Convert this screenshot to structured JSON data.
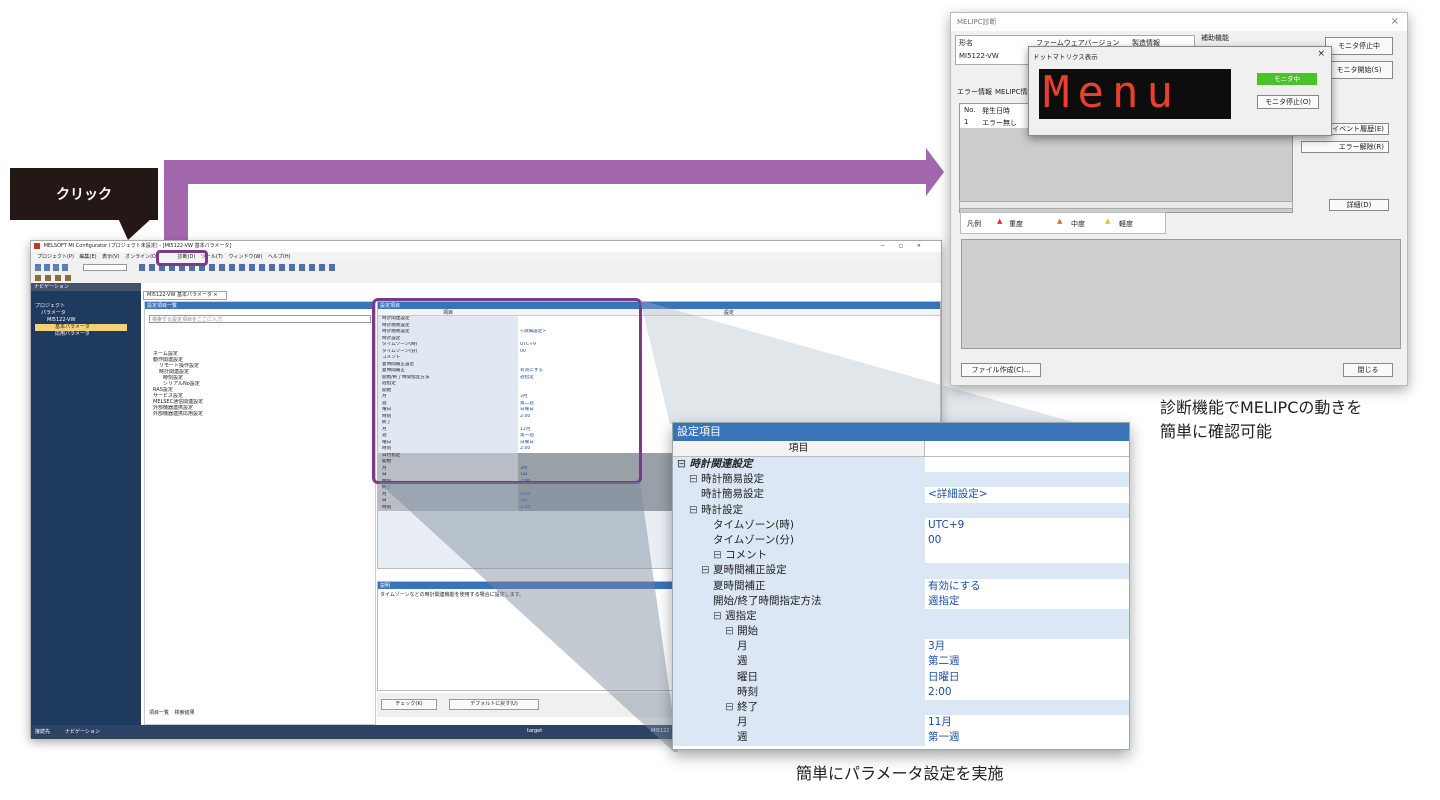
{
  "callout": {
    "text": "クリック"
  },
  "app": {
    "title": "MELSOFT MI Configurator (プロジェクト未設定) - [MI5122-VW 基本パラメータ]",
    "window_controls": [
      "−",
      "◻",
      "×"
    ],
    "menus": [
      "プロジェクト(P)",
      "編集(E)",
      "表示(V)",
      "オンライン(O)",
      "診断(D)",
      "ツール(T)",
      "ウィンドウ(W)",
      "ヘルプ(H)"
    ],
    "nav_header": "ナビゲーション",
    "nav_items": [
      "プロジェクト",
      "パラメータ",
      "MI5122-VW",
      "基本パラメータ",
      "応用パラメータ"
    ],
    "doc_tab": "MI5122-VW 基本パラメータ ×",
    "tree_header": "設定項目一覧",
    "search_placeholder": "検索する設定項目をここに入力",
    "tree_items": [
      "ネーム設定",
      "動作関連設定",
      "リモート操作設定",
      "時計関連設定",
      "時刻設定",
      "シリアルNo設定",
      "RAS設定",
      "サービス設定",
      "MELSEC通信関連設定",
      "外部機器連携設定",
      "外部機器連携応用設定"
    ],
    "tree_tabs": [
      "項目一覧",
      "検索結果"
    ],
    "grid_header": "設定項目",
    "grid_cols": [
      "項目",
      "設定"
    ],
    "grid_rows": [
      [
        "時計関連設定",
        ""
      ],
      [
        "時計簡易設定",
        ""
      ],
      [
        "時計簡易設定",
        "<詳細設定>"
      ],
      [
        "時計設定",
        ""
      ],
      [
        "タイムゾーン(時)",
        "UTC+9"
      ],
      [
        "タイムゾーン(分)",
        "00"
      ],
      [
        "コメント",
        ""
      ],
      [
        "夏時間補正設定",
        ""
      ],
      [
        "夏時間補正",
        "有効にする"
      ],
      [
        "開始/終了時間指定方法",
        "週指定"
      ],
      [
        "週指定",
        ""
      ],
      [
        "開始",
        ""
      ],
      [
        "月",
        "3月"
      ],
      [
        "週",
        "第二週"
      ],
      [
        "曜日",
        "日曜日"
      ],
      [
        "時刻",
        "2:00"
      ],
      [
        "終了",
        ""
      ],
      [
        "月",
        "11月"
      ],
      [
        "週",
        "第一週"
      ],
      [
        "曜日",
        "日曜日"
      ],
      [
        "時刻",
        "2:00"
      ],
      [
        "日付指定",
        ""
      ],
      [
        "開始",
        ""
      ],
      [
        "月",
        "3月"
      ],
      [
        "日",
        "1日"
      ],
      [
        "時刻",
        "2:00"
      ],
      [
        "終了",
        ""
      ],
      [
        "月",
        "11月"
      ],
      [
        "日",
        "1日"
      ],
      [
        "時刻",
        "2:00"
      ]
    ],
    "desc_header": "説明",
    "desc_text": "タイムゾーンなどの時計関連機能を使用する場合に設定します。",
    "check_button": "チェック(K)",
    "default_button": "デフォルトに戻す(U)",
    "status_left": "接続先",
    "status_nav": "ナビゲーション",
    "status_target": "target",
    "status_right": "MI5122"
  },
  "zoom": {
    "header": "設定項目",
    "col_item": "項目",
    "rows": [
      {
        "label": "時計関連設定",
        "value": "",
        "indent": 0,
        "bold": true,
        "band": false
      },
      {
        "label": "時計簡易設定",
        "value": "",
        "indent": 1,
        "band": true
      },
      {
        "label": "時計簡易設定",
        "value": "<詳細設定>",
        "indent": 2,
        "band": false
      },
      {
        "label": "時計設定",
        "value": "",
        "indent": 1,
        "band": true
      },
      {
        "label": "タイムゾーン(時)",
        "value": "UTC+9",
        "indent": 3,
        "band": false
      },
      {
        "label": "タイムゾーン(分)",
        "value": "00",
        "indent": 3,
        "band": false
      },
      {
        "label": "コメント",
        "value": "",
        "indent": 3,
        "band": false
      },
      {
        "label": "夏時間補正設定",
        "value": "",
        "indent": 2,
        "band": true
      },
      {
        "label": "夏時間補正",
        "value": "有効にする",
        "indent": 3,
        "band": false
      },
      {
        "label": "開始/終了時間指定方法",
        "value": "週指定",
        "indent": 3,
        "band": false
      },
      {
        "label": "週指定",
        "value": "",
        "indent": 3,
        "band": true
      },
      {
        "label": "開始",
        "value": "",
        "indent": 4,
        "band": true
      },
      {
        "label": "月",
        "value": "3月",
        "indent": 5,
        "band": false
      },
      {
        "label": "週",
        "value": "第二週",
        "indent": 5,
        "band": false
      },
      {
        "label": "曜日",
        "value": "日曜日",
        "indent": 5,
        "band": false
      },
      {
        "label": "時刻",
        "value": "2:00",
        "indent": 5,
        "band": false
      },
      {
        "label": "終了",
        "value": "",
        "indent": 4,
        "band": true
      },
      {
        "label": "月",
        "value": "11月",
        "indent": 5,
        "band": false
      },
      {
        "label": "週",
        "value": "第一週",
        "indent": 5,
        "band": false
      }
    ]
  },
  "melipc": {
    "title": "MELIPC診断",
    "col_model": "形名",
    "col_fw": "ファームウェアバージョン",
    "col_mfg": "製造情報",
    "model": "MI5122-VW",
    "aux_label": "補助機能",
    "stop_monitor": "モニタ停止中",
    "start_monitor": "モニタ開始(S)",
    "tab_error": "エラー情報",
    "tab_melipc": "MELIPC情報",
    "col_no": "No.",
    "col_time": "発生日時",
    "err_no": "1",
    "err_text": "エラー無し",
    "event_history": "イベント履歴(E)",
    "error_clear": "エラー解除(R)",
    "detail": "詳細(D)",
    "legend_label": "凡例",
    "legend_major": "重度",
    "legend_moderate": "中度",
    "legend_minor": "軽度",
    "file_create": "ファイル作成(C)...",
    "close": "閉じる",
    "dot_title": "ドットマトリクス表示",
    "dot_text": "Menu",
    "dot_status": "モニタ中",
    "dot_stop": "モニタ停止(O)"
  },
  "captions": {
    "right_line1": "診断機能でMELIPCの動きを",
    "right_line2": "簡単に確認可能",
    "bottom": "簡単にパラメータ設定を実施"
  },
  "colors": {
    "accent": "#a367ad",
    "highlight": "#7a3a8a",
    "header_blue": "#3b73b9",
    "led": "#e8402c",
    "monitor_green": "#4cc22a"
  }
}
